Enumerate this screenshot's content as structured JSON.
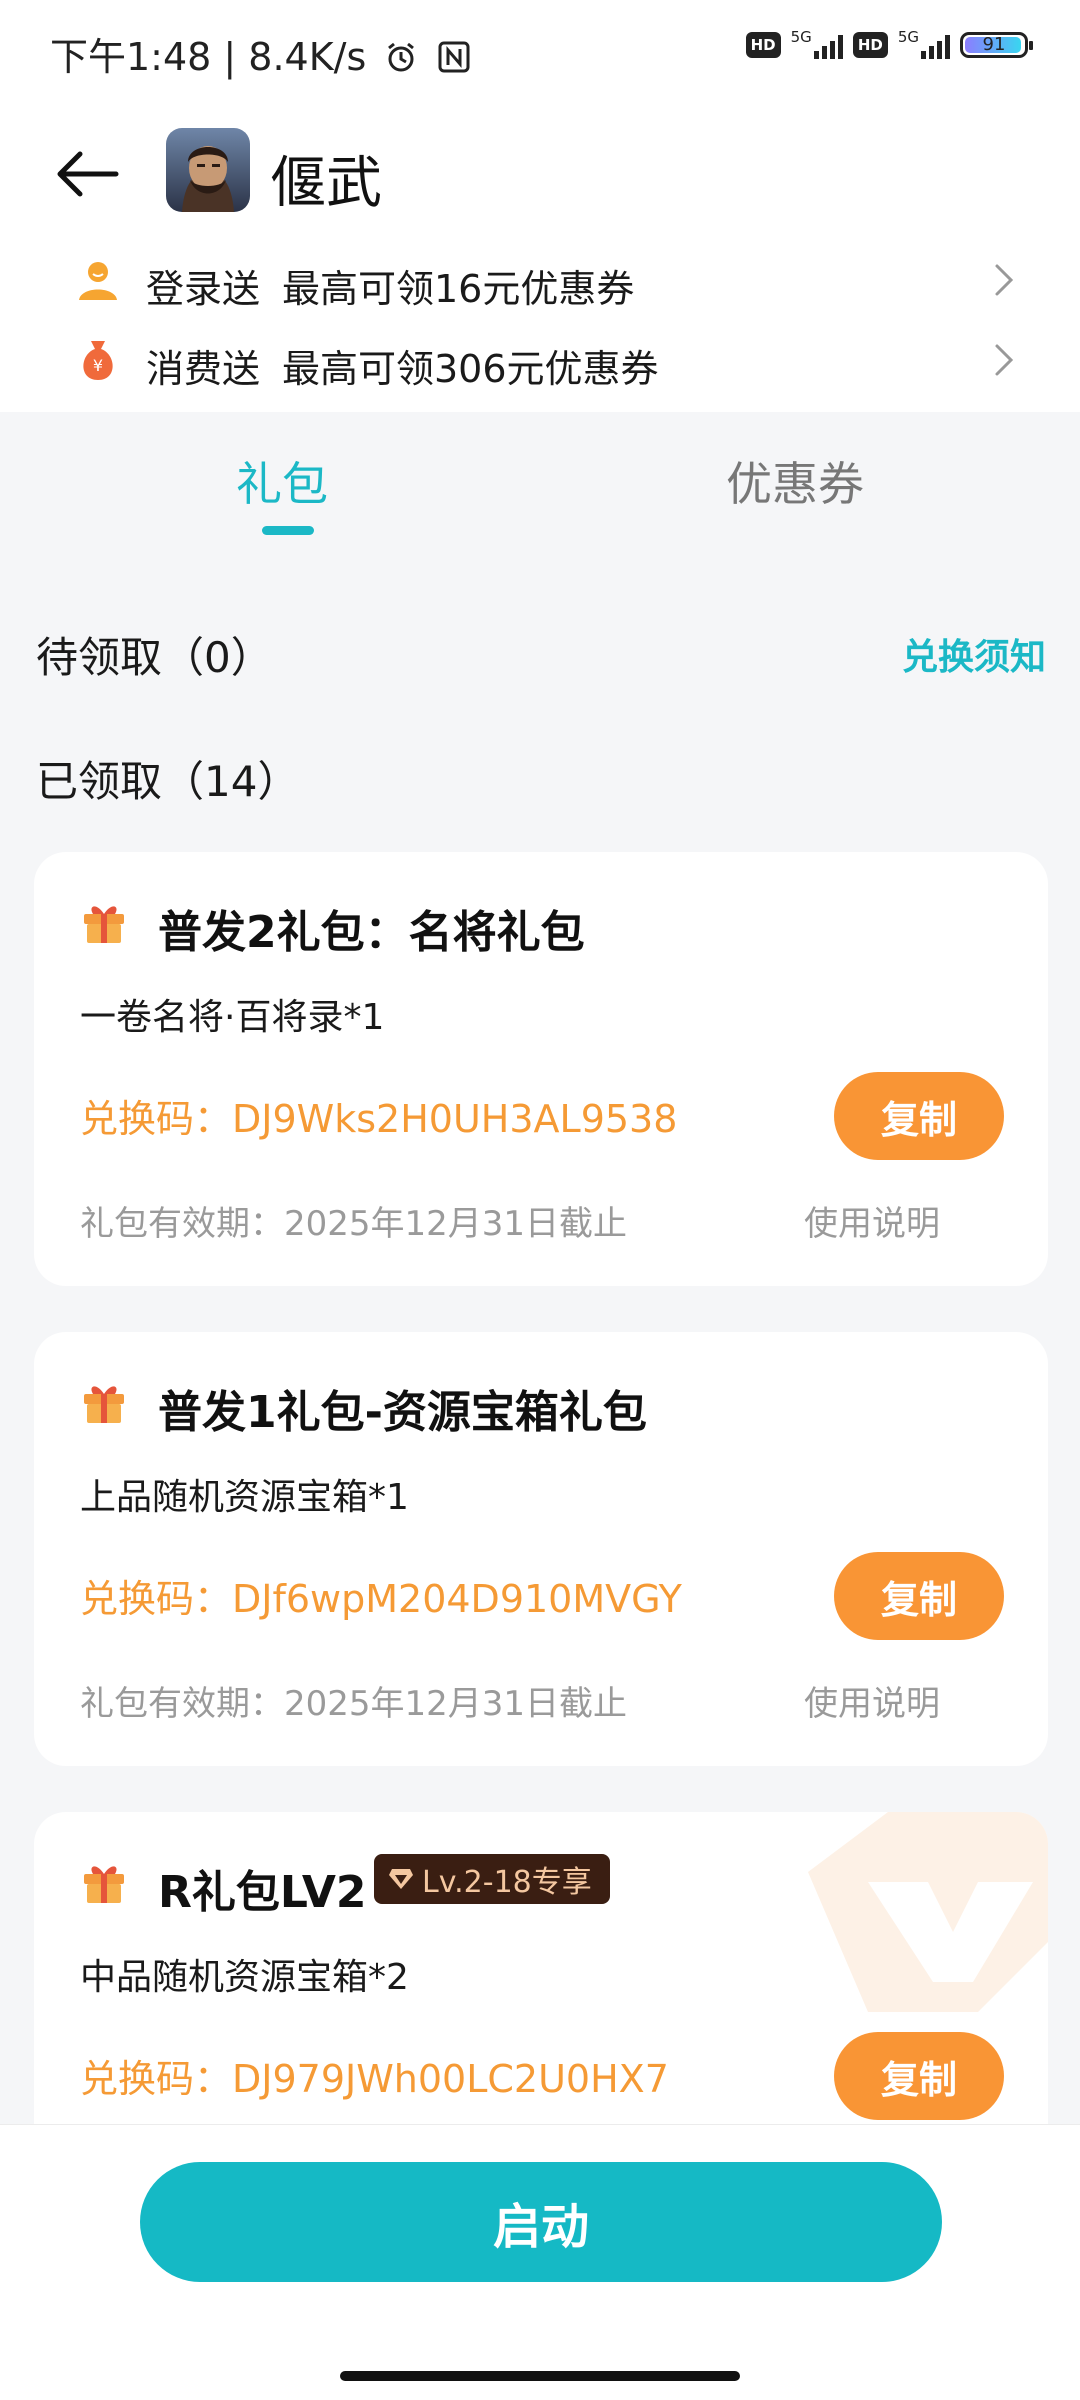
{
  "status_bar": {
    "time_and_speed": "下午1:48 | 8.4K/s",
    "hd_label": "HD",
    "network_1": "5G",
    "network_2": "5G",
    "battery": "91"
  },
  "header": {
    "game_title": "偃武",
    "icons": {
      "back": "back-arrow-icon",
      "game": "game-avatar-icon"
    }
  },
  "promos": [
    {
      "label": "登录送",
      "desc": "最高可领16元优惠券",
      "icon": "person-icon",
      "color": "#f6a531"
    },
    {
      "label": "消费送",
      "desc": "最高可领306元优惠券",
      "icon": "money-bag-icon",
      "color": "#f06a3b"
    }
  ],
  "tabs": [
    {
      "label": "礼包",
      "active": true
    },
    {
      "label": "优惠券",
      "active": false
    }
  ],
  "sections": {
    "pending": "待领取（0）",
    "exchange_notice": "兑换须知",
    "claimed": "已领取（14）"
  },
  "gifts": [
    {
      "title": "普发2礼包：名将礼包",
      "content": "一卷名将·百将录*1",
      "code_label": "兑换码：",
      "code": "DJ9Wks2H0UH3AL9538",
      "copy_label": "复制",
      "validity": "礼包有效期：2025年12月31日截止",
      "usage_label": "使用说明"
    },
    {
      "title": "普发1礼包-资源宝箱礼包",
      "content": "上品随机资源宝箱*1",
      "code_label": "兑换码：",
      "code": "DJf6wpM204D910MVGY",
      "copy_label": "复制",
      "validity": "礼包有效期：2025年12月31日截止",
      "usage_label": "使用说明"
    },
    {
      "title": "R礼包LV2",
      "badge": "Lv.2-18专享",
      "content": "中品随机资源宝箱*2",
      "code_label": "兑换码：",
      "code": "DJ979JWh00LC2U0HX7",
      "copy_label": "复制"
    }
  ],
  "bottom": {
    "launch_label": "启动"
  },
  "colors": {
    "accent": "#1bb8c6",
    "copy_button": "#f99535",
    "code_text": "#f59a35",
    "badge_bg": "#3a1e12"
  }
}
